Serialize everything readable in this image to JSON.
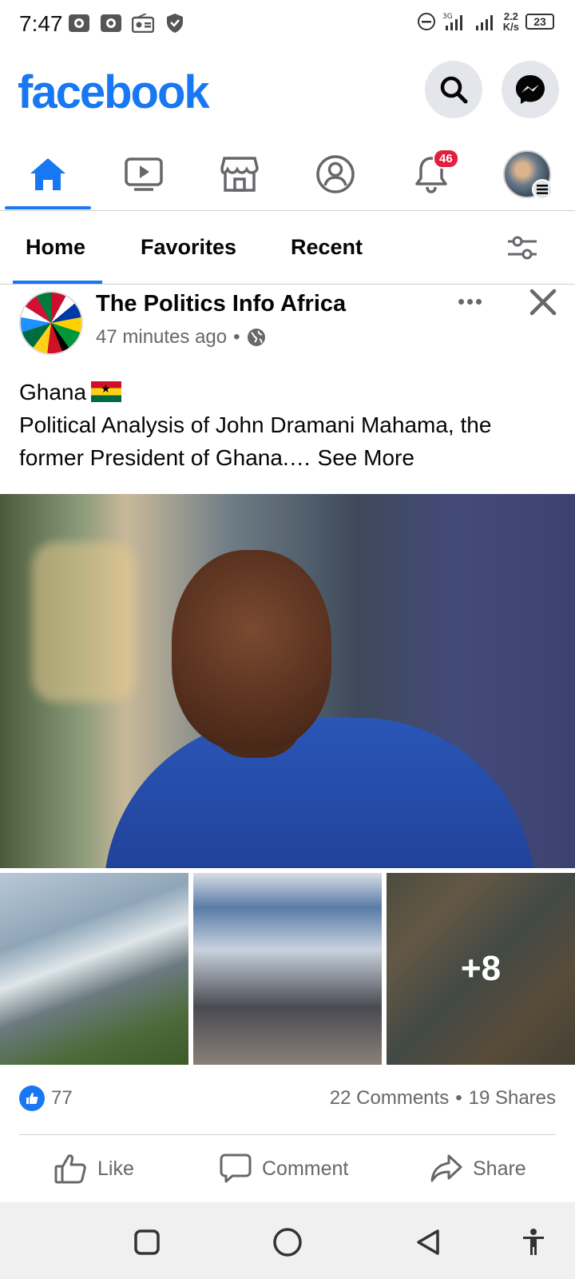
{
  "status_bar": {
    "time": "7:47",
    "network_type": "3G",
    "speed_value": "2.2",
    "speed_unit": "K/s",
    "battery": "23"
  },
  "header": {
    "logo": "facebook",
    "brand_color": "#1877f2"
  },
  "nav": {
    "tabs": [
      "home-icon",
      "video-icon",
      "marketplace-icon",
      "profile-icon",
      "notifications-icon",
      "menu-avatar"
    ],
    "notifications_badge": "46"
  },
  "feed_tabs": {
    "items": [
      {
        "label": "Home"
      },
      {
        "label": "Favorites"
      },
      {
        "label": "Recent"
      }
    ]
  },
  "post": {
    "page_name": "The Politics Info Africa",
    "time": "47 minutes ago",
    "separator": "•",
    "text_line1": "Ghana",
    "text_body": "Political Analysis of John Dramani Mahama, the former President of Ghana.… ",
    "see_more": "See More",
    "more_photos": "+8",
    "likes": "77",
    "comments": "22 Comments",
    "shares": "19 Shares",
    "dot": "•"
  },
  "actions": {
    "like": "Like",
    "comment": "Comment",
    "share": "Share"
  }
}
